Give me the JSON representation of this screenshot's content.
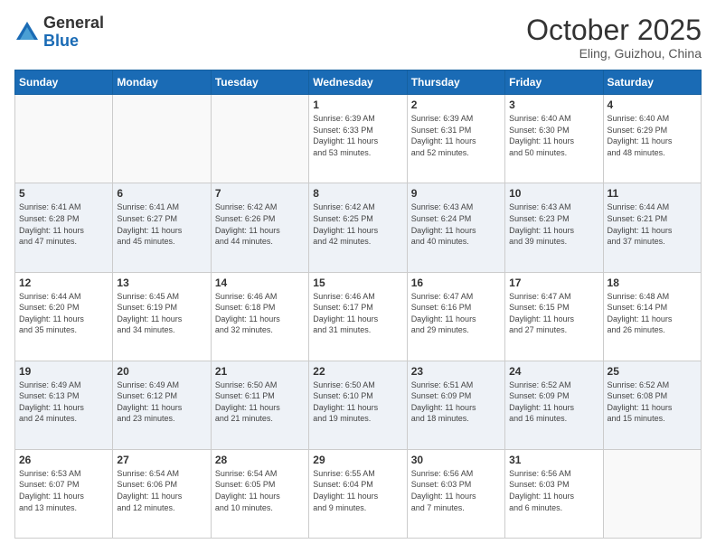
{
  "header": {
    "logo_general": "General",
    "logo_blue": "Blue",
    "month": "October 2025",
    "location": "Eling, Guizhou, China"
  },
  "weekdays": [
    "Sunday",
    "Monday",
    "Tuesday",
    "Wednesday",
    "Thursday",
    "Friday",
    "Saturday"
  ],
  "weeks": [
    [
      {
        "day": "",
        "info": ""
      },
      {
        "day": "",
        "info": ""
      },
      {
        "day": "",
        "info": ""
      },
      {
        "day": "1",
        "info": "Sunrise: 6:39 AM\nSunset: 6:33 PM\nDaylight: 11 hours\nand 53 minutes."
      },
      {
        "day": "2",
        "info": "Sunrise: 6:39 AM\nSunset: 6:31 PM\nDaylight: 11 hours\nand 52 minutes."
      },
      {
        "day": "3",
        "info": "Sunrise: 6:40 AM\nSunset: 6:30 PM\nDaylight: 11 hours\nand 50 minutes."
      },
      {
        "day": "4",
        "info": "Sunrise: 6:40 AM\nSunset: 6:29 PM\nDaylight: 11 hours\nand 48 minutes."
      }
    ],
    [
      {
        "day": "5",
        "info": "Sunrise: 6:41 AM\nSunset: 6:28 PM\nDaylight: 11 hours\nand 47 minutes."
      },
      {
        "day": "6",
        "info": "Sunrise: 6:41 AM\nSunset: 6:27 PM\nDaylight: 11 hours\nand 45 minutes."
      },
      {
        "day": "7",
        "info": "Sunrise: 6:42 AM\nSunset: 6:26 PM\nDaylight: 11 hours\nand 44 minutes."
      },
      {
        "day": "8",
        "info": "Sunrise: 6:42 AM\nSunset: 6:25 PM\nDaylight: 11 hours\nand 42 minutes."
      },
      {
        "day": "9",
        "info": "Sunrise: 6:43 AM\nSunset: 6:24 PM\nDaylight: 11 hours\nand 40 minutes."
      },
      {
        "day": "10",
        "info": "Sunrise: 6:43 AM\nSunset: 6:23 PM\nDaylight: 11 hours\nand 39 minutes."
      },
      {
        "day": "11",
        "info": "Sunrise: 6:44 AM\nSunset: 6:21 PM\nDaylight: 11 hours\nand 37 minutes."
      }
    ],
    [
      {
        "day": "12",
        "info": "Sunrise: 6:44 AM\nSunset: 6:20 PM\nDaylight: 11 hours\nand 35 minutes."
      },
      {
        "day": "13",
        "info": "Sunrise: 6:45 AM\nSunset: 6:19 PM\nDaylight: 11 hours\nand 34 minutes."
      },
      {
        "day": "14",
        "info": "Sunrise: 6:46 AM\nSunset: 6:18 PM\nDaylight: 11 hours\nand 32 minutes."
      },
      {
        "day": "15",
        "info": "Sunrise: 6:46 AM\nSunset: 6:17 PM\nDaylight: 11 hours\nand 31 minutes."
      },
      {
        "day": "16",
        "info": "Sunrise: 6:47 AM\nSunset: 6:16 PM\nDaylight: 11 hours\nand 29 minutes."
      },
      {
        "day": "17",
        "info": "Sunrise: 6:47 AM\nSunset: 6:15 PM\nDaylight: 11 hours\nand 27 minutes."
      },
      {
        "day": "18",
        "info": "Sunrise: 6:48 AM\nSunset: 6:14 PM\nDaylight: 11 hours\nand 26 minutes."
      }
    ],
    [
      {
        "day": "19",
        "info": "Sunrise: 6:49 AM\nSunset: 6:13 PM\nDaylight: 11 hours\nand 24 minutes."
      },
      {
        "day": "20",
        "info": "Sunrise: 6:49 AM\nSunset: 6:12 PM\nDaylight: 11 hours\nand 23 minutes."
      },
      {
        "day": "21",
        "info": "Sunrise: 6:50 AM\nSunset: 6:11 PM\nDaylight: 11 hours\nand 21 minutes."
      },
      {
        "day": "22",
        "info": "Sunrise: 6:50 AM\nSunset: 6:10 PM\nDaylight: 11 hours\nand 19 minutes."
      },
      {
        "day": "23",
        "info": "Sunrise: 6:51 AM\nSunset: 6:09 PM\nDaylight: 11 hours\nand 18 minutes."
      },
      {
        "day": "24",
        "info": "Sunrise: 6:52 AM\nSunset: 6:09 PM\nDaylight: 11 hours\nand 16 minutes."
      },
      {
        "day": "25",
        "info": "Sunrise: 6:52 AM\nSunset: 6:08 PM\nDaylight: 11 hours\nand 15 minutes."
      }
    ],
    [
      {
        "day": "26",
        "info": "Sunrise: 6:53 AM\nSunset: 6:07 PM\nDaylight: 11 hours\nand 13 minutes."
      },
      {
        "day": "27",
        "info": "Sunrise: 6:54 AM\nSunset: 6:06 PM\nDaylight: 11 hours\nand 12 minutes."
      },
      {
        "day": "28",
        "info": "Sunrise: 6:54 AM\nSunset: 6:05 PM\nDaylight: 11 hours\nand 10 minutes."
      },
      {
        "day": "29",
        "info": "Sunrise: 6:55 AM\nSunset: 6:04 PM\nDaylight: 11 hours\nand 9 minutes."
      },
      {
        "day": "30",
        "info": "Sunrise: 6:56 AM\nSunset: 6:03 PM\nDaylight: 11 hours\nand 7 minutes."
      },
      {
        "day": "31",
        "info": "Sunrise: 6:56 AM\nSunset: 6:03 PM\nDaylight: 11 hours\nand 6 minutes."
      },
      {
        "day": "",
        "info": ""
      }
    ]
  ]
}
